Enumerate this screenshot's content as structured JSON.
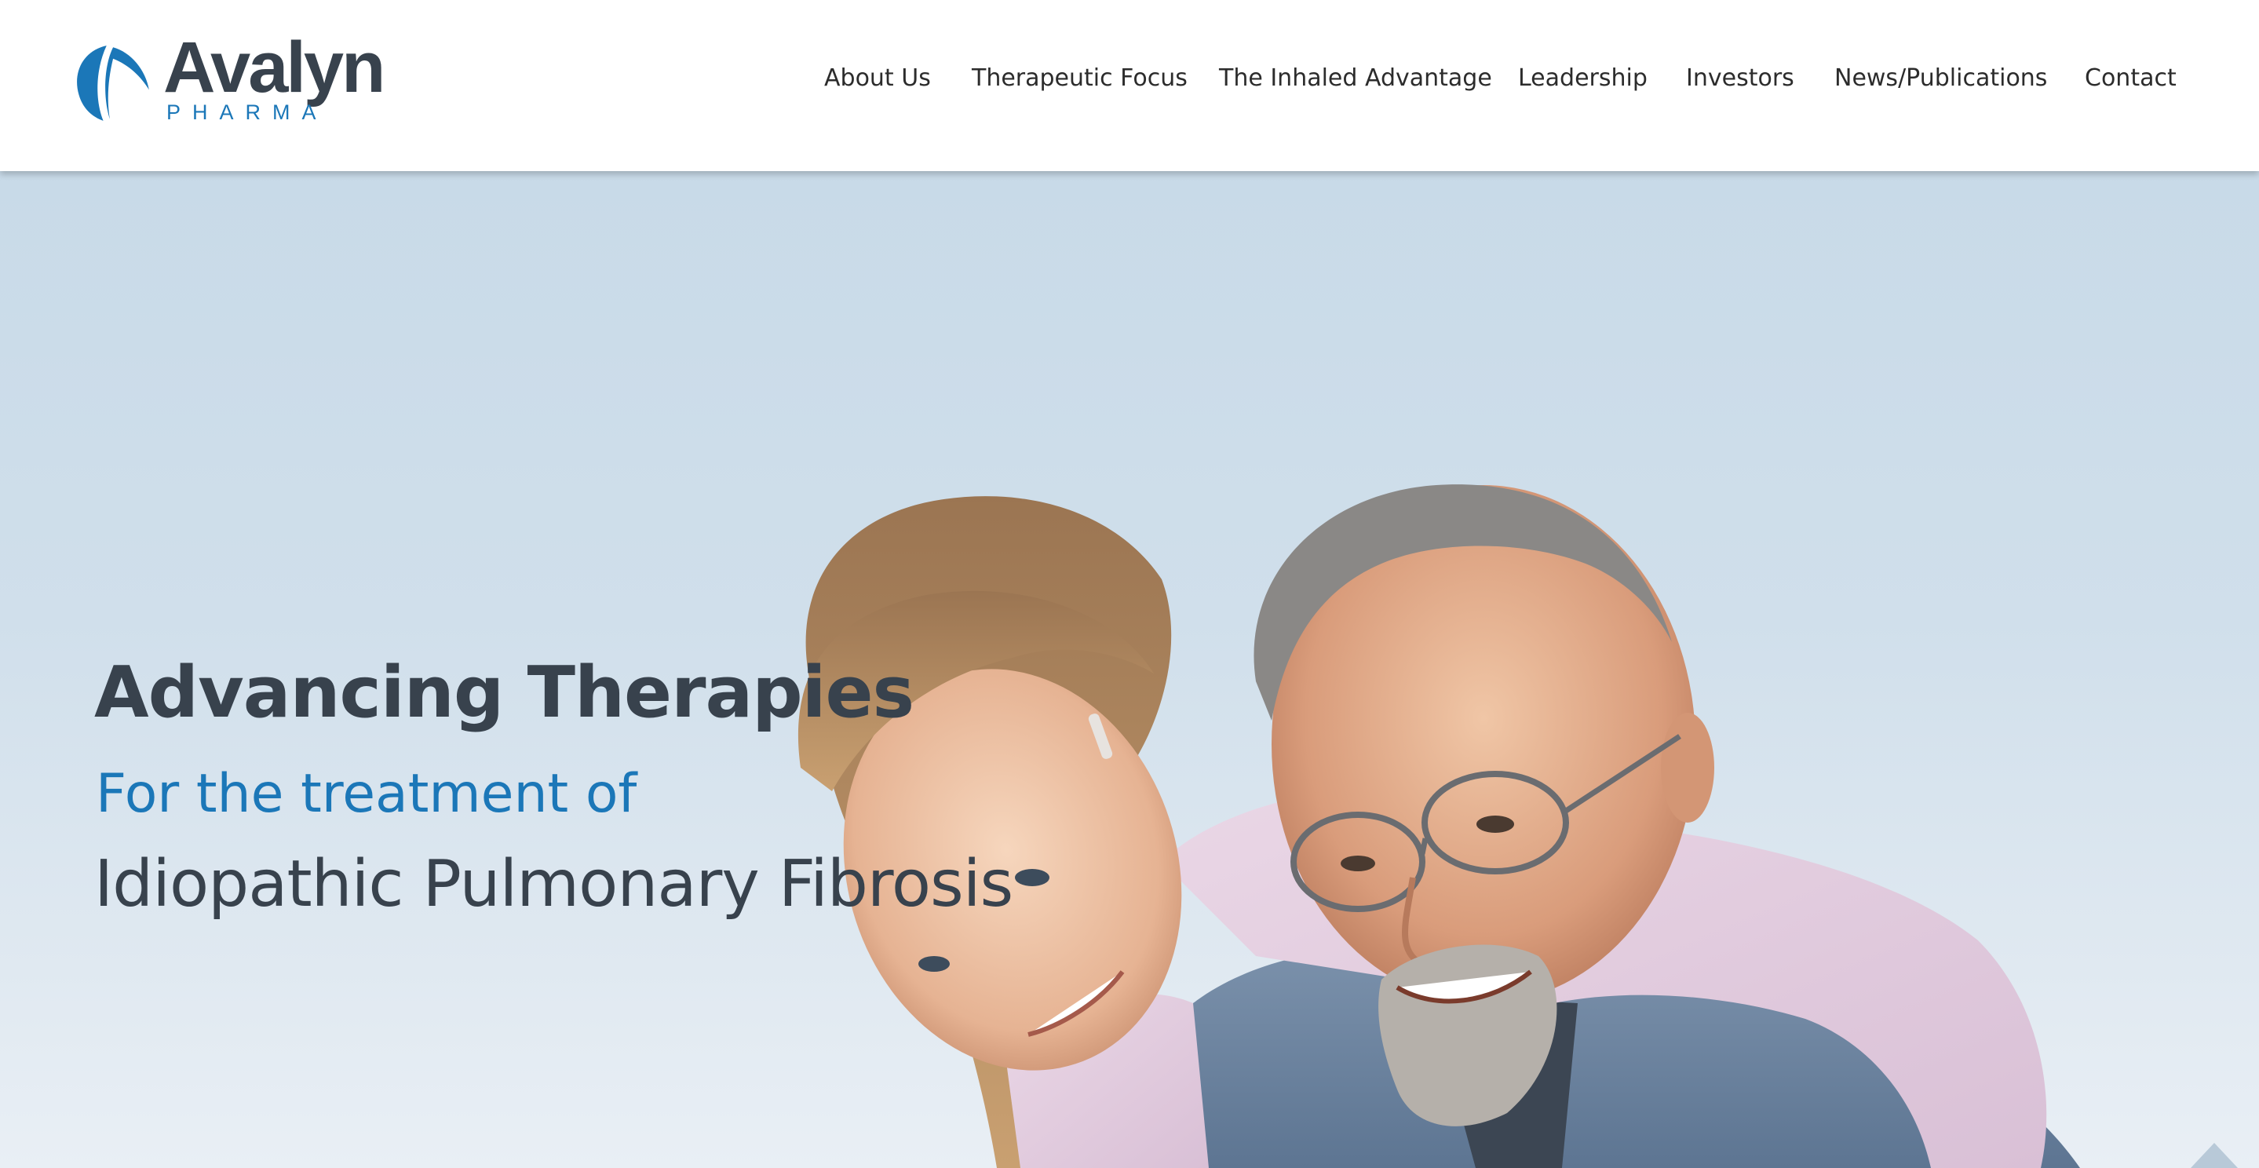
{
  "brand": {
    "name": "Avalyn",
    "tagline": "PHARMA",
    "logo_icon": "leaf-swoosh-icon",
    "colors": {
      "primary": "#1b77b8",
      "dark": "#38424d"
    }
  },
  "nav": {
    "items": [
      {
        "label": "About Us"
      },
      {
        "label": "Therapeutic Focus"
      },
      {
        "label": "The Inhaled Advantage"
      },
      {
        "label": "Leadership"
      },
      {
        "label": "Investors"
      },
      {
        "label": "News/Publications"
      },
      {
        "label": "Contact"
      }
    ]
  },
  "hero": {
    "headline": "Advancing Therapies",
    "subheadline": "For the treatment of",
    "condition": "Idiopathic Pulmonary Fibrosis",
    "photo": "Smiling girl hugging an older man with glasses",
    "scroll_icon": "triangle-up-icon"
  }
}
